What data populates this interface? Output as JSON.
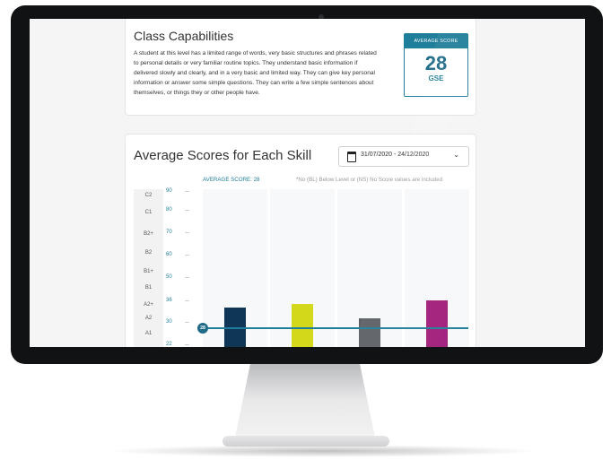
{
  "capabilities": {
    "title": "Class Capabilities",
    "lines": [
      "A student at this level has a limited range of words, very basic structures and phrases related",
      "to personal details or very familiar routine topics. They understand basic information if",
      "delivered slowly and clearly, and in a very basic and limited way. They can give key personal",
      "information or answer some simple questions. They can write a few simple sentences about",
      "themselves, or things they or other people have."
    ],
    "score_box": {
      "label": "AVERAGE SCORE",
      "value": "28",
      "unit": "GSE"
    }
  },
  "skills": {
    "title": "Average Scores for Each Skill",
    "date_range": "31/07/2020 - 24/12/2020",
    "average_label": "AVERAGE SCORE: 28",
    "note": "*No (BL) Below Level or (NS) No Score values are included",
    "average_marker": "28"
  },
  "chart_data": {
    "type": "bar",
    "y_ticks": [
      "90",
      "80",
      "70",
      "60",
      "50",
      "36",
      "30",
      "22"
    ],
    "cefr_levels": [
      "C2",
      "C1",
      "B2+",
      "B2",
      "B1+",
      "B1",
      "A2+",
      "A2",
      "A1"
    ],
    "average": 28,
    "series": [
      {
        "value": 34,
        "color": "#0f3557"
      },
      {
        "value": 35,
        "color": "#d3d91a"
      },
      {
        "value": 31,
        "color": "#5b5f64"
      },
      {
        "value": 36,
        "color": "#a01d7a"
      }
    ]
  }
}
